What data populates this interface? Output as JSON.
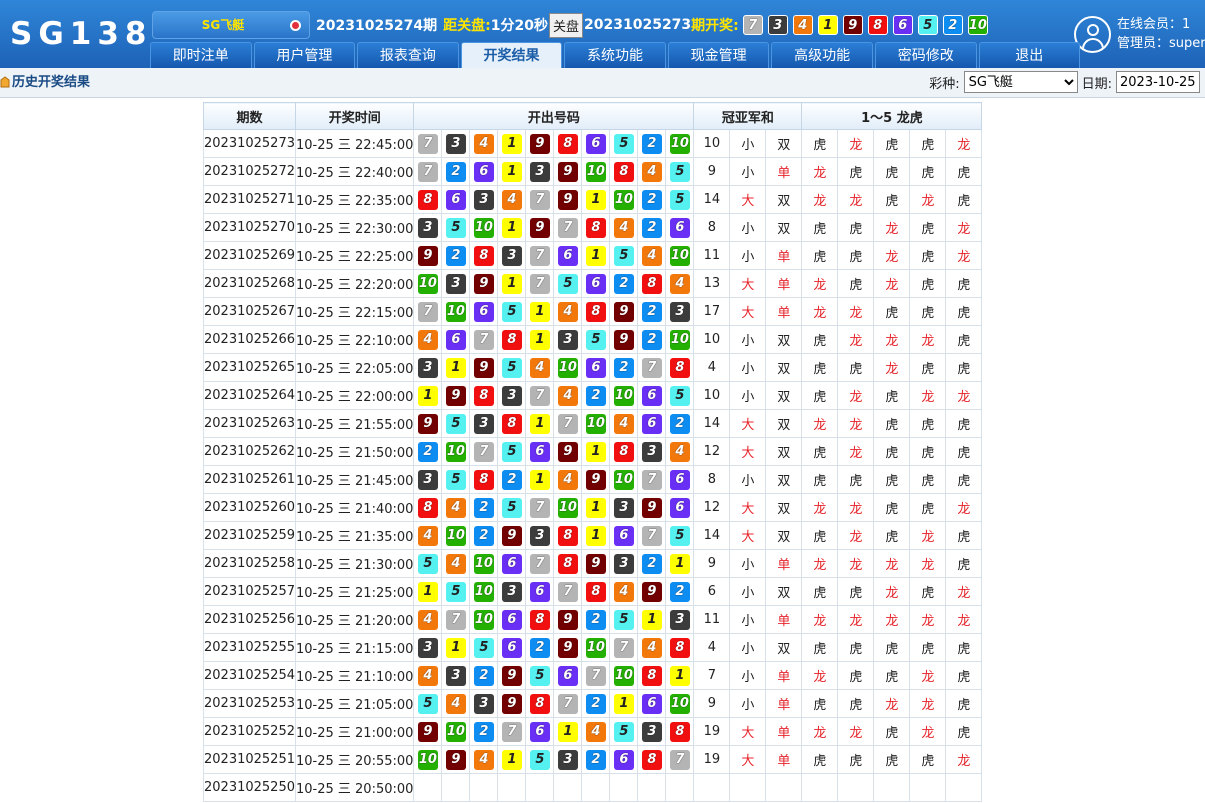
{
  "app": {
    "logo": "SG138"
  },
  "header": {
    "game_name": "SG飞艇",
    "current_period": "20231025274期",
    "countdown_label": "距关盘:",
    "countdown": "1分20秒",
    "close_button": "关盘",
    "last_period": "20231025273",
    "last_label": "期开奖:",
    "last_numbers": [
      7,
      3,
      4,
      1,
      9,
      8,
      6,
      5,
      2,
      10
    ],
    "online_text": "在线会员：1",
    "admin_text": "管理员：super"
  },
  "nav": {
    "items": [
      "即时注单",
      "用户管理",
      "报表查询",
      "开奖结果",
      "系统功能",
      "现金管理",
      "高级功能",
      "密码修改",
      "退出"
    ],
    "active": "开奖结果"
  },
  "subbar": {
    "title": "历史开奖结果",
    "lottery_label": "彩种:",
    "lottery_value": "SG飞艇",
    "date_label": "日期:",
    "date_value": "2023-10-25"
  },
  "table": {
    "headers": [
      "期数",
      "开奖时间",
      "开出号码",
      "冠亚军和",
      "1～5 龙虎"
    ],
    "ball_colors": {
      "1": "#ffff00",
      "2": "#0d8cf2",
      "3": "#3c3c3c",
      "4": "#f2780c",
      "5": "#55f0f0",
      "6": "#6a2ff5",
      "7": "#b4b4b4",
      "8": "#f20f10",
      "9": "#720000",
      "10": "#23b000"
    },
    "rows": [
      {
        "period": "20231025273",
        "time": "10-25 三 22:45:00",
        "nums": [
          7,
          3,
          4,
          1,
          9,
          8,
          6,
          5,
          2,
          10
        ],
        "sum": "10",
        "size": "小",
        "parity": "双",
        "dt": [
          "虎",
          "龙",
          "虎",
          "虎",
          "龙"
        ]
      },
      {
        "period": "20231025272",
        "time": "10-25 三 22:40:00",
        "nums": [
          7,
          2,
          6,
          1,
          3,
          9,
          10,
          8,
          4,
          5
        ],
        "sum": "9",
        "size": "小",
        "parity": "单",
        "dt": [
          "龙",
          "虎",
          "虎",
          "虎",
          "虎"
        ]
      },
      {
        "period": "20231025271",
        "time": "10-25 三 22:35:00",
        "nums": [
          8,
          6,
          3,
          4,
          7,
          9,
          1,
          10,
          2,
          5
        ],
        "sum": "14",
        "size": "大",
        "parity": "双",
        "dt": [
          "龙",
          "龙",
          "虎",
          "龙",
          "虎"
        ]
      },
      {
        "period": "20231025270",
        "time": "10-25 三 22:30:00",
        "nums": [
          3,
          5,
          10,
          1,
          9,
          7,
          8,
          4,
          2,
          6
        ],
        "sum": "8",
        "size": "小",
        "parity": "双",
        "dt": [
          "虎",
          "虎",
          "龙",
          "虎",
          "龙"
        ]
      },
      {
        "period": "20231025269",
        "time": "10-25 三 22:25:00",
        "nums": [
          9,
          2,
          8,
          3,
          7,
          6,
          1,
          5,
          4,
          10
        ],
        "sum": "11",
        "size": "小",
        "parity": "单",
        "dt": [
          "虎",
          "虎",
          "龙",
          "虎",
          "龙"
        ]
      },
      {
        "period": "20231025268",
        "time": "10-25 三 22:20:00",
        "nums": [
          10,
          3,
          9,
          1,
          7,
          5,
          6,
          2,
          8,
          4
        ],
        "sum": "13",
        "size": "大",
        "parity": "单",
        "dt": [
          "龙",
          "虎",
          "龙",
          "虎",
          "虎"
        ]
      },
      {
        "period": "20231025267",
        "time": "10-25 三 22:15:00",
        "nums": [
          7,
          10,
          6,
          5,
          1,
          4,
          8,
          9,
          2,
          3
        ],
        "sum": "17",
        "size": "大",
        "parity": "单",
        "dt": [
          "龙",
          "龙",
          "虎",
          "虎",
          "虎"
        ]
      },
      {
        "period": "20231025266",
        "time": "10-25 三 22:10:00",
        "nums": [
          4,
          6,
          7,
          8,
          1,
          3,
          5,
          9,
          2,
          10
        ],
        "sum": "10",
        "size": "小",
        "parity": "双",
        "dt": [
          "虎",
          "龙",
          "龙",
          "龙",
          "虎"
        ]
      },
      {
        "period": "20231025265",
        "time": "10-25 三 22:05:00",
        "nums": [
          3,
          1,
          9,
          5,
          4,
          10,
          6,
          2,
          7,
          8
        ],
        "sum": "4",
        "size": "小",
        "parity": "双",
        "dt": [
          "虎",
          "虎",
          "龙",
          "虎",
          "虎"
        ]
      },
      {
        "period": "20231025264",
        "time": "10-25 三 22:00:00",
        "nums": [
          1,
          9,
          8,
          3,
          7,
          4,
          2,
          10,
          6,
          5
        ],
        "sum": "10",
        "size": "小",
        "parity": "双",
        "dt": [
          "虎",
          "龙",
          "虎",
          "龙",
          "龙"
        ]
      },
      {
        "period": "20231025263",
        "time": "10-25 三 21:55:00",
        "nums": [
          9,
          5,
          3,
          8,
          1,
          7,
          10,
          4,
          6,
          2
        ],
        "sum": "14",
        "size": "大",
        "parity": "双",
        "dt": [
          "龙",
          "龙",
          "虎",
          "虎",
          "虎"
        ]
      },
      {
        "period": "20231025262",
        "time": "10-25 三 21:50:00",
        "nums": [
          2,
          10,
          7,
          5,
          6,
          9,
          1,
          8,
          3,
          4
        ],
        "sum": "12",
        "size": "大",
        "parity": "双",
        "dt": [
          "虎",
          "龙",
          "虎",
          "虎",
          "虎"
        ]
      },
      {
        "period": "20231025261",
        "time": "10-25 三 21:45:00",
        "nums": [
          3,
          5,
          8,
          2,
          1,
          4,
          9,
          10,
          7,
          6
        ],
        "sum": "8",
        "size": "小",
        "parity": "双",
        "dt": [
          "虎",
          "虎",
          "虎",
          "虎",
          "虎"
        ]
      },
      {
        "period": "20231025260",
        "time": "10-25 三 21:40:00",
        "nums": [
          8,
          4,
          2,
          5,
          7,
          10,
          1,
          3,
          9,
          6
        ],
        "sum": "12",
        "size": "大",
        "parity": "双",
        "dt": [
          "龙",
          "龙",
          "虎",
          "虎",
          "龙"
        ]
      },
      {
        "period": "20231025259",
        "time": "10-25 三 21:35:00",
        "nums": [
          4,
          10,
          2,
          9,
          3,
          8,
          1,
          6,
          7,
          5
        ],
        "sum": "14",
        "size": "大",
        "parity": "双",
        "dt": [
          "虎",
          "龙",
          "虎",
          "龙",
          "虎"
        ]
      },
      {
        "period": "20231025258",
        "time": "10-25 三 21:30:00",
        "nums": [
          5,
          4,
          10,
          6,
          7,
          8,
          9,
          3,
          2,
          1
        ],
        "sum": "9",
        "size": "小",
        "parity": "单",
        "dt": [
          "龙",
          "龙",
          "龙",
          "龙",
          "虎"
        ]
      },
      {
        "period": "20231025257",
        "time": "10-25 三 21:25:00",
        "nums": [
          1,
          5,
          10,
          3,
          6,
          7,
          8,
          4,
          9,
          2
        ],
        "sum": "6",
        "size": "小",
        "parity": "双",
        "dt": [
          "虎",
          "虎",
          "龙",
          "虎",
          "龙"
        ]
      },
      {
        "period": "20231025256",
        "time": "10-25 三 21:20:00",
        "nums": [
          4,
          7,
          10,
          6,
          8,
          9,
          2,
          5,
          1,
          3
        ],
        "sum": "11",
        "size": "小",
        "parity": "单",
        "dt": [
          "龙",
          "龙",
          "龙",
          "龙",
          "龙"
        ]
      },
      {
        "period": "20231025255",
        "time": "10-25 三 21:15:00",
        "nums": [
          3,
          1,
          5,
          6,
          2,
          9,
          10,
          7,
          4,
          8
        ],
        "sum": "4",
        "size": "小",
        "parity": "双",
        "dt": [
          "虎",
          "虎",
          "虎",
          "虎",
          "虎"
        ]
      },
      {
        "period": "20231025254",
        "time": "10-25 三 21:10:00",
        "nums": [
          4,
          3,
          2,
          9,
          5,
          6,
          7,
          10,
          8,
          1
        ],
        "sum": "7",
        "size": "小",
        "parity": "单",
        "dt": [
          "龙",
          "虎",
          "虎",
          "龙",
          "虎"
        ]
      },
      {
        "period": "20231025253",
        "time": "10-25 三 21:05:00",
        "nums": [
          5,
          4,
          3,
          9,
          8,
          7,
          2,
          1,
          6,
          10
        ],
        "sum": "9",
        "size": "小",
        "parity": "单",
        "dt": [
          "虎",
          "虎",
          "龙",
          "龙",
          "虎"
        ]
      },
      {
        "period": "20231025252",
        "time": "10-25 三 21:00:00",
        "nums": [
          9,
          10,
          2,
          7,
          6,
          1,
          4,
          5,
          3,
          8
        ],
        "sum": "19",
        "size": "大",
        "parity": "单",
        "dt": [
          "龙",
          "龙",
          "虎",
          "龙",
          "虎"
        ]
      },
      {
        "period": "20231025251",
        "time": "10-25 三 20:55:00",
        "nums": [
          10,
          9,
          4,
          1,
          5,
          3,
          2,
          6,
          8,
          7
        ],
        "sum": "19",
        "size": "大",
        "parity": "单",
        "dt": [
          "虎",
          "虎",
          "虎",
          "虎",
          "龙"
        ]
      },
      {
        "period": "20231025250",
        "time": "10-25 三 20:50:00",
        "nums": [],
        "sum": "",
        "size": "",
        "parity": "",
        "dt": []
      }
    ]
  }
}
